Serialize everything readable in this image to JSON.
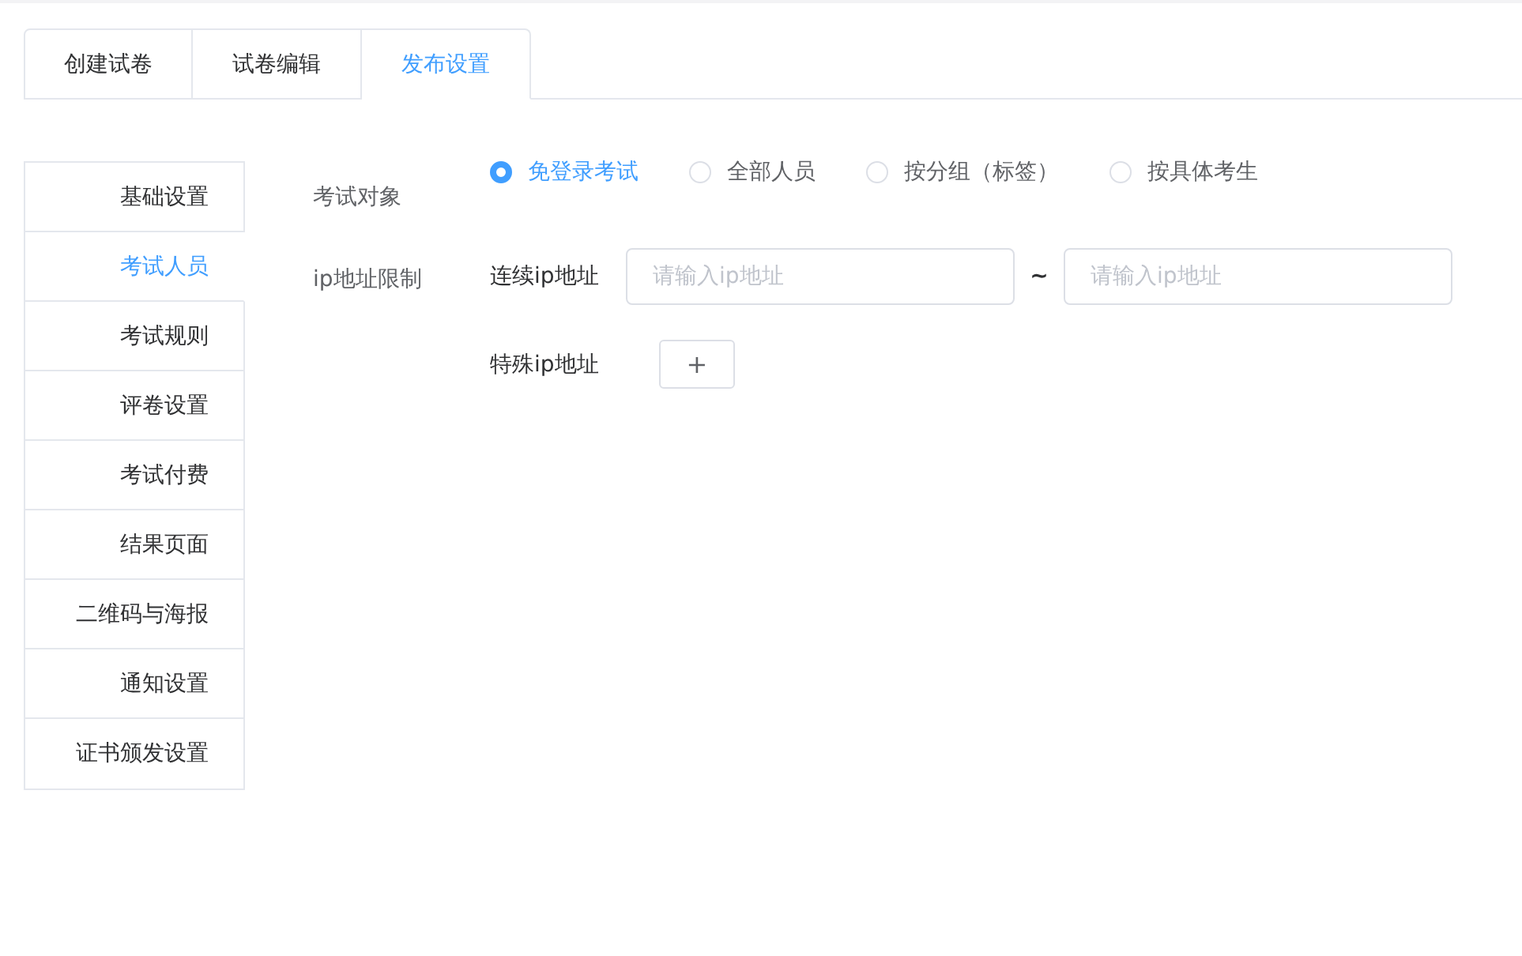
{
  "tabs": [
    {
      "label": "创建试卷",
      "selected": false
    },
    {
      "label": "试卷编辑",
      "selected": false
    },
    {
      "label": "发布设置",
      "selected": true
    }
  ],
  "sidebar": {
    "items": [
      {
        "label": "基础设置",
        "selected": false
      },
      {
        "label": "考试人员",
        "selected": true
      },
      {
        "label": "考试规则",
        "selected": false
      },
      {
        "label": "评卷设置",
        "selected": false
      },
      {
        "label": "考试付费",
        "selected": false
      },
      {
        "label": "结果页面",
        "selected": false
      },
      {
        "label": "二维码与海报",
        "selected": false
      },
      {
        "label": "通知设置",
        "selected": false
      },
      {
        "label": "证书颁发设置",
        "selected": false
      }
    ]
  },
  "sections": [
    {
      "label": "考试对象"
    },
    {
      "label": "ip地址限制"
    }
  ],
  "exam_target": {
    "options": [
      {
        "label": "免登录考试",
        "selected": true
      },
      {
        "label": "全部人员",
        "selected": false
      },
      {
        "label": "按分组（标签）",
        "selected": false
      },
      {
        "label": "按具体考生",
        "selected": false
      }
    ]
  },
  "ip_range": {
    "label": "连续ip地址",
    "start_placeholder": "请输入ip地址",
    "separator": "~",
    "end_placeholder": "请输入ip地址"
  },
  "special_ip": {
    "label": "特殊ip地址",
    "add_button": "+"
  }
}
